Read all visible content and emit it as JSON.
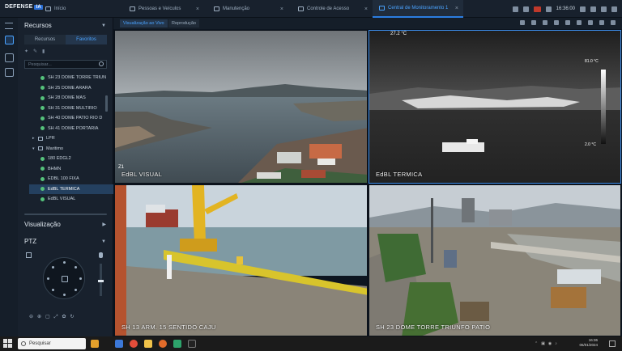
{
  "app": {
    "brand": "DEFENSE",
    "brand_badge": "IA"
  },
  "tabs": [
    {
      "label": "Início"
    },
    {
      "label": "Pessoas e Veículos"
    },
    {
      "label": "Manutenção"
    },
    {
      "label": "Controle de Acesso"
    },
    {
      "label": "Central de Monitoramento 1"
    }
  ],
  "clock": "16:36:00",
  "sidebar": {
    "title": "Recursos",
    "subtabs": [
      "Recursos",
      "Favoritos"
    ],
    "search_placeholder": "Pesquisar...",
    "items": [
      {
        "label": "SH 23 DOME TORRE TRIUN",
        "kind": "camera"
      },
      {
        "label": "SH 25 DOME ARARA",
        "kind": "camera"
      },
      {
        "label": "SH 28 DOME MAS",
        "kind": "camera"
      },
      {
        "label": "SH 31 DOME MULTIRIO",
        "kind": "camera"
      },
      {
        "label": "SH 40 DOME PATIO RIO D",
        "kind": "camera"
      },
      {
        "label": "SH 41 DOME PORTARIA",
        "kind": "camera"
      },
      {
        "label": "LPR",
        "kind": "folder"
      },
      {
        "label": "Maritimo",
        "kind": "folder"
      },
      {
        "label": "180 EDGL2",
        "kind": "camera"
      },
      {
        "label": "BHMN",
        "kind": "camera"
      },
      {
        "label": "EDBL 100 FIXA",
        "kind": "camera"
      },
      {
        "label": "EdBL TERMICA",
        "kind": "camera"
      },
      {
        "label": "EdBL VISUAL",
        "kind": "camera"
      }
    ],
    "visualizacao": "Visualização",
    "ptz": "PTZ"
  },
  "view_tabs": [
    "Visualização ao Vivo",
    "Reprodução"
  ],
  "tiles": [
    {
      "label": "EdBL VISUAL"
    },
    {
      "label": "EdBL TERMICA"
    },
    {
      "label": "SH 13 ARM. 15 SENTIDO CAJU"
    },
    {
      "label": "SH 23 DOME TORRE TRIUNFO PATIO"
    }
  ],
  "thermal": {
    "temp_top": "27.2 °C",
    "temp_scale_top": "81.0 °C",
    "temp_scale_bottom": "2.0 °C",
    "tile_small_text": "Z1"
  },
  "taskbar": {
    "search_placeholder": "Pesquisar",
    "time": "16:36",
    "date": "06/01/2024"
  }
}
